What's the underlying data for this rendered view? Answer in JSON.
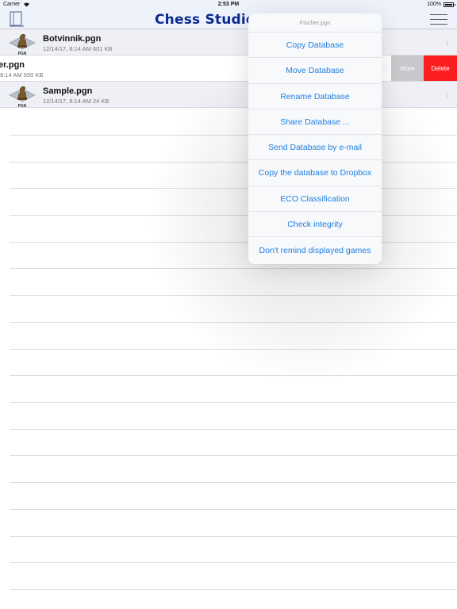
{
  "status_bar": {
    "carrier": "Carrier",
    "time": "2:53 PM",
    "battery": "100%"
  },
  "nav": {
    "title": "Chess Studio D",
    "title_color": "#0b2a8f"
  },
  "files": [
    {
      "name": "Botvinnik.pgn",
      "meta": "12/14/17, 8:14 AM  601 KB",
      "icon": "pgn-file-icon"
    },
    {
      "name": "er.pgn",
      "meta": ", 8:14 AM  550 KB",
      "icon": "pgn-file-icon",
      "swiped": true
    },
    {
      "name": "Sample.pgn",
      "meta": "12/14/17, 8:14 AM  24 KB",
      "icon": "pgn-file-icon"
    }
  ],
  "swipe_actions": {
    "more": "More",
    "delete": "Delete",
    "more_color": "#c7c7cc",
    "delete_color": "#fc1e1e"
  },
  "popover": {
    "header": "Fischer.pgn",
    "accent": "#1f7fe0",
    "items": [
      "Copy Database",
      "Move Database",
      "Rename Database",
      "Share Database ...",
      "Send Database by e-mail",
      "Copy the database to Dropbox",
      "ECO Classification",
      "Check integrity",
      "Don't remind displayed games"
    ]
  }
}
